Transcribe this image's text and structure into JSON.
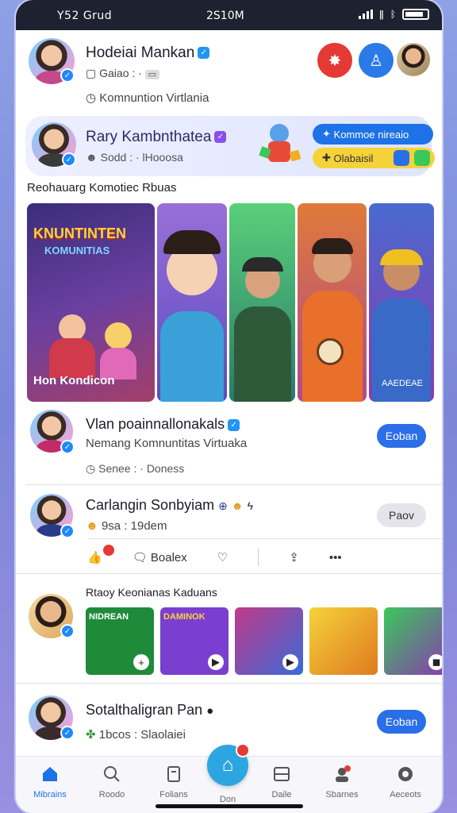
{
  "status_bar": {
    "carrier": "Y52  Grud",
    "time": "2S10M"
  },
  "header": {
    "name": "Hodeiai Mankan",
    "sub": "Gaiao : ·",
    "location": "Komnuntion Virtlania"
  },
  "promo": {
    "name": "Rary Kambnthatea",
    "sub": "Sodd : · lHooosa",
    "pill_top": "Kommoe nireaio",
    "pill_bottom": "Olabaisil"
  },
  "section_title": "Reohauarg Komotiec Rbuas",
  "banners": [
    {
      "caption": "Hon Kondicon",
      "headline": "KNUNTINTEN",
      "headline2": "KOMUNITIAS"
    },
    {
      "caption": ""
    },
    {
      "caption": ""
    },
    {
      "caption": ""
    },
    {
      "caption": ""
    }
  ],
  "banner_tags": [
    "",
    "",
    "",
    "",
    "AAEDEAE"
  ],
  "posts": [
    {
      "name": "Vlan poainnallonakals",
      "line2": "Nemang Komnuntitas Virtuaka",
      "line3": "Senee : · Doness",
      "cta": "Eoban",
      "cta_style": "primary"
    },
    {
      "name": "Carlangin Sonbyiam",
      "line2": "9sa : 19dem",
      "cta": "Paov",
      "cta_style": "secondary"
    },
    {
      "name": "Sotalthaligran Pan",
      "line2": "1bcos : Slaolaiei",
      "cta": "Eoban",
      "cta_style": "primary"
    }
  ],
  "actions": {
    "comment": "Boalex"
  },
  "gallery": {
    "title": "Rtaoy Keonianas Kaduans",
    "thumbs": [
      {
        "title": "NIDREAN",
        "bg": "#1f8a3a"
      },
      {
        "title": "DAMINOK",
        "bg": "#7a3fd1"
      },
      {
        "title": "",
        "bg": "#b03a8c"
      },
      {
        "title": "",
        "bg": "#f0c020"
      },
      {
        "title": "",
        "bg": "#3aa55a"
      }
    ]
  },
  "tabs": [
    {
      "label": "Mibrains",
      "icon": "home-icon",
      "active": true
    },
    {
      "label": "Roodo",
      "icon": "search-icon"
    },
    {
      "label": "Folians",
      "icon": "document-icon"
    },
    {
      "label": "Don",
      "icon": "house-icon"
    },
    {
      "label": "Daile",
      "icon": "tray-icon"
    },
    {
      "label": "Sbarnes",
      "icon": "profile-icon"
    },
    {
      "label": "Aeceots",
      "icon": "circle-icon"
    }
  ],
  "colors": {
    "accent": "#2196f3",
    "red_action": "#e53935",
    "blue_action": "#2a7ae8",
    "primary_cta": "#2a6ee8",
    "secondary_cta": "#e4e4ea"
  }
}
